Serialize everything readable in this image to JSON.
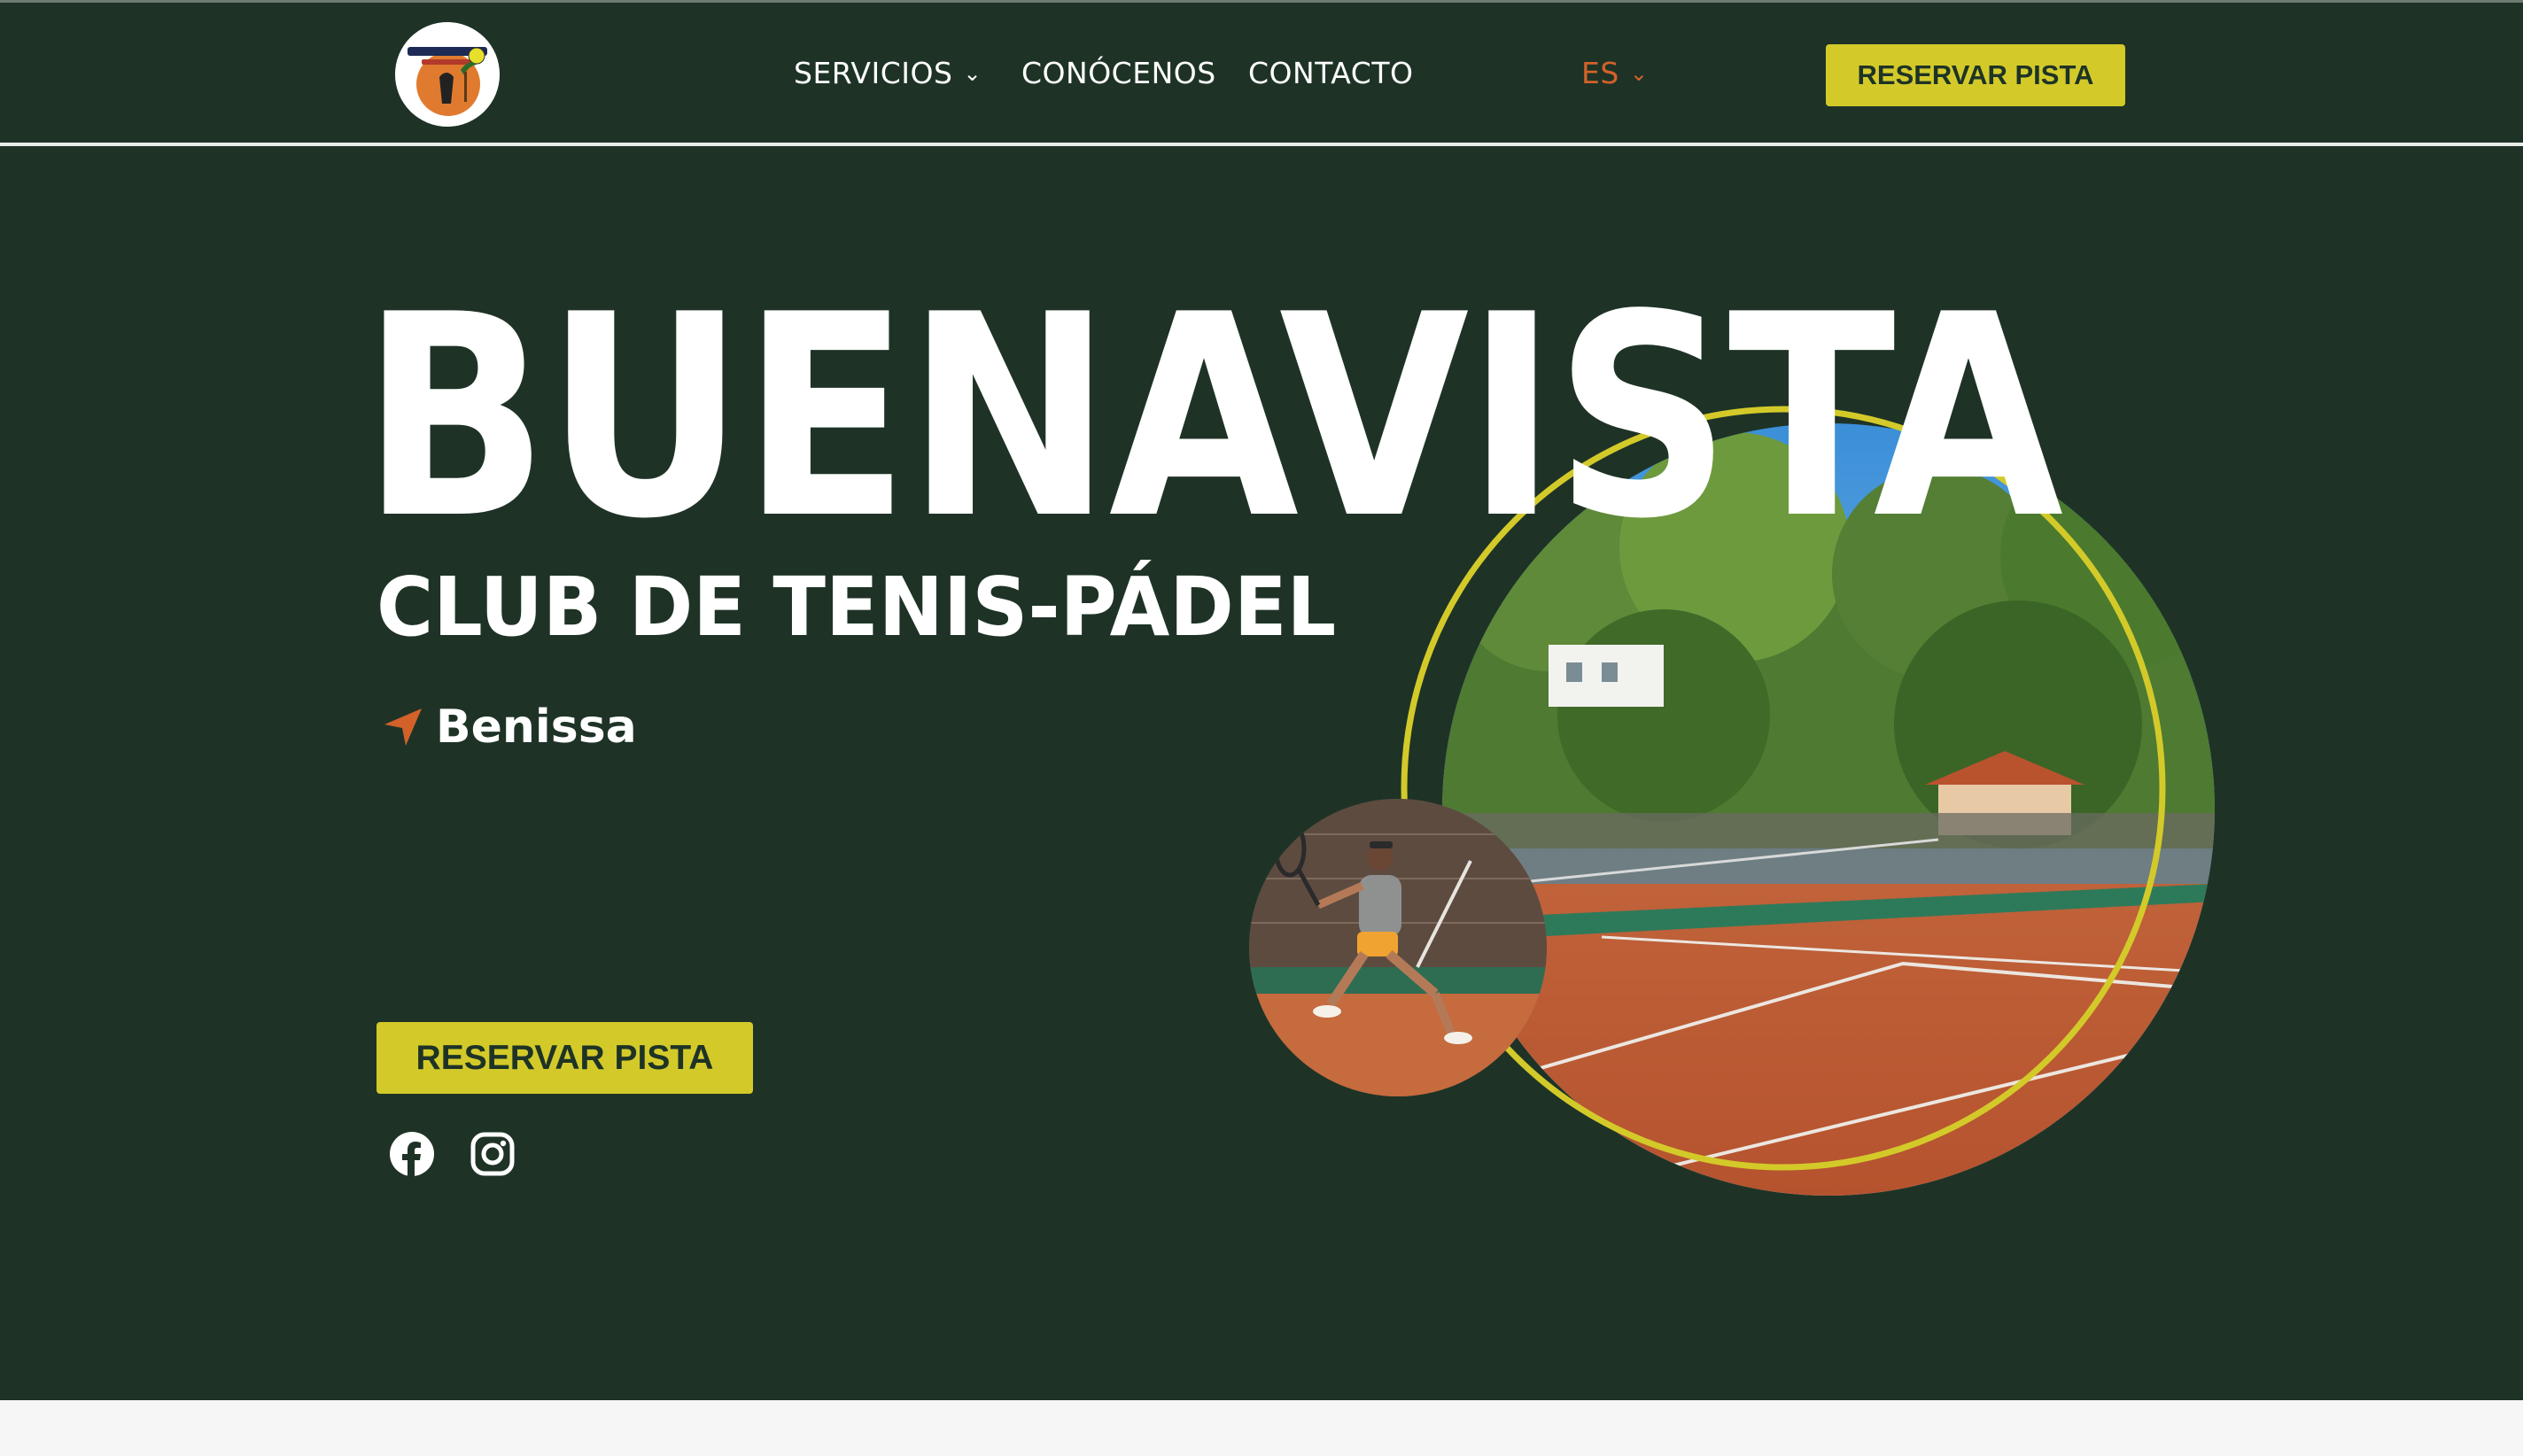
{
  "header": {
    "logo_alt": "Buenavista Benissa Club de Tenis logo",
    "nav": [
      {
        "label": "SERVICIOS",
        "has_dropdown": true
      },
      {
        "label": "CONÓCENOS",
        "has_dropdown": false
      },
      {
        "label": "CONTACTO",
        "has_dropdown": false
      }
    ],
    "language": {
      "selected": "ES",
      "icon": "chevron-down-icon"
    },
    "cta_label": "RESERVAR PISTA"
  },
  "hero": {
    "title": "BUENAVISTA",
    "subtitle": "CLUB DE TENIS-PÁDEL",
    "location": {
      "icon": "location-arrow-icon",
      "label": "Benissa"
    },
    "cta_label": "RESERVAR PISTA",
    "social": [
      {
        "name": "facebook-icon"
      },
      {
        "name": "instagram-icon"
      }
    ],
    "images": [
      {
        "name": "clay-court-photo"
      },
      {
        "name": "tennis-player-photo"
      }
    ]
  },
  "colors": {
    "background": "#1e3326",
    "accent": "#d3ca2a",
    "location_icon": "#d2622a",
    "text": "#ffffff",
    "clay": "#c4633a"
  }
}
